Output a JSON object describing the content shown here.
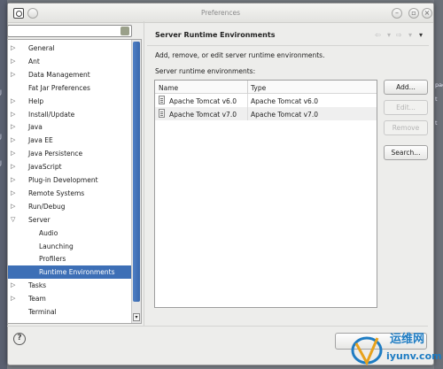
{
  "window": {
    "title": "Preferences"
  },
  "filter": {
    "value": "",
    "placeholder": ""
  },
  "tree": [
    {
      "label": "General",
      "expandable": true,
      "indent": 0
    },
    {
      "label": "Ant",
      "expandable": true,
      "indent": 0
    },
    {
      "label": "Data Management",
      "expandable": true,
      "indent": 0
    },
    {
      "label": "Fat Jar Preferences",
      "expandable": false,
      "indent": 0
    },
    {
      "label": "Help",
      "expandable": true,
      "indent": 0
    },
    {
      "label": "Install/Update",
      "expandable": true,
      "indent": 0
    },
    {
      "label": "Java",
      "expandable": true,
      "indent": 0
    },
    {
      "label": "Java EE",
      "expandable": true,
      "indent": 0
    },
    {
      "label": "Java Persistence",
      "expandable": true,
      "indent": 0
    },
    {
      "label": "JavaScript",
      "expandable": true,
      "indent": 0
    },
    {
      "label": "Plug-in Development",
      "expandable": true,
      "indent": 0
    },
    {
      "label": "Remote Systems",
      "expandable": true,
      "indent": 0
    },
    {
      "label": "Run/Debug",
      "expandable": true,
      "indent": 0
    },
    {
      "label": "Server",
      "expandable": true,
      "expanded": true,
      "indent": 0
    },
    {
      "label": "Audio",
      "expandable": false,
      "indent": 1
    },
    {
      "label": "Launching",
      "expandable": false,
      "indent": 1
    },
    {
      "label": "Profilers",
      "expandable": false,
      "indent": 1
    },
    {
      "label": "Runtime Environments",
      "expandable": false,
      "indent": 1,
      "selected": true
    },
    {
      "label": "Tasks",
      "expandable": true,
      "indent": 0
    },
    {
      "label": "Team",
      "expandable": true,
      "indent": 0
    },
    {
      "label": "Terminal",
      "expandable": false,
      "indent": 0
    }
  ],
  "page": {
    "title": "Server Runtime Environments",
    "description": "Add, remove, or edit server runtime environments.",
    "list_label": "Server runtime environments:"
  },
  "table": {
    "headers": [
      "Name",
      "Type"
    ],
    "rows": [
      {
        "name": "Apache Tomcat v6.0",
        "type": "Apache Tomcat v6.0"
      },
      {
        "name": "Apache Tomcat v7.0",
        "type": "Apache Tomcat v7.0"
      }
    ]
  },
  "buttons": {
    "add": "Add...",
    "edit": "Edit...",
    "remove": "Remove",
    "search": "Search..."
  },
  "help": {
    "label": "?"
  },
  "watermark": {
    "line1": "运维网",
    "line2": "iyunv.com"
  },
  "background": {
    "left_text": [
      "J",
      "J",
      "J",
      "J",
      "J"
    ],
    "right_text": [
      "pag",
      "t",
      "t"
    ]
  }
}
